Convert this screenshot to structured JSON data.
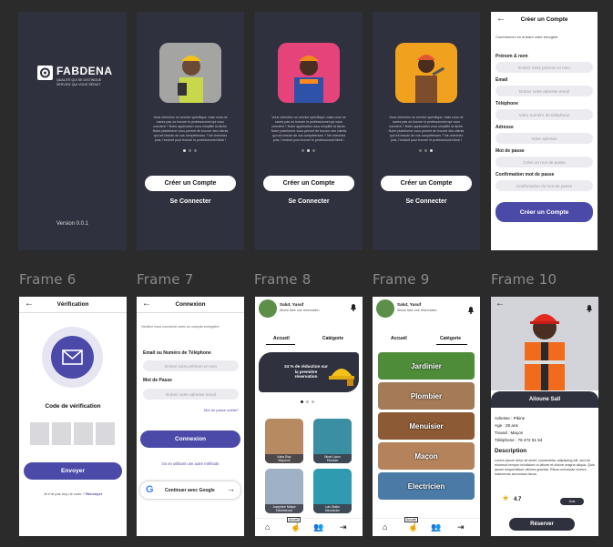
{
  "frame_labels": [
    "Frame 6",
    "Frame 7",
    "Frame 8",
    "Frame 9",
    "Frame 10"
  ],
  "splash": {
    "brand": "FABDENA",
    "brand_tagline_1": "QUALITÉ QUI SE DISTINGUE",
    "brand_tagline_2": "SERVICE QUI VOUS SÉDUIT",
    "version": "Version 0.0.1"
  },
  "onboarding": {
    "paragraph": "Vous cherchez un service spécifique, mais vous ne savez pas où trouver le professionnel qui vous convient ? Notre application vous simplifie la tâche. Notre plateforme vous permet de trouver des clients qui ont besoin de vos compétences ? Ne cherchez plus, l'endroit pour trouver le professionnel idéal !",
    "create_label": "Créer un Compte",
    "login_label": "Se Connecter"
  },
  "signup": {
    "title": "Créer un Compte",
    "intro": "Commencez en entrant votre enregistr",
    "fields": [
      {
        "label": "Prénom & nom",
        "placeholder": "Entrez votre prénom et nom"
      },
      {
        "label": "Email",
        "placeholder": "Entrez votre adresse email"
      },
      {
        "label": "Téléphone",
        "placeholder": "Votre numéro de téléphone"
      },
      {
        "label": "Adresse",
        "placeholder": "Votre adresse"
      },
      {
        "label": "Mot de passe",
        "placeholder": "Créer un mot de passe"
      },
      {
        "label": "Confirmation mot de passe",
        "placeholder": "Confirmation du mot de passe"
      }
    ],
    "submit": "Créer un Compte"
  },
  "verification": {
    "title": "Vérification",
    "code_label": "Code de vérification",
    "send": "Envoyer",
    "resend_prompt": "Je n'ai pas reçu le code ?",
    "resend_link": "Renvoyer"
  },
  "login": {
    "title": "Connexion",
    "intro": "Veuillez vous connecter avec un compte enregistré",
    "email_label": "Email ou Numéro de Téléphone",
    "email_placeholder": "Entrez votre prénom et nom",
    "password_label": "Mot de Passe",
    "password_placeholder": "Entrez votre adresse email",
    "forgot": "Mot de passe oublié?",
    "submit": "Connexion",
    "alt": "Ou en utilisant une autre méthode",
    "google": "Continuer avec Google"
  },
  "home": {
    "greeting": "Salut, Yusuf",
    "subtitle": "Allons faire une réservation",
    "tab_home": "Accueil",
    "tab_category": "Catégorie",
    "promo": "24 % de réduction sur la première réservation",
    "workers": [
      {
        "name": "Kaba Diop",
        "job": "Maçonne"
      },
      {
        "name": "Nkosi Lulum",
        "job": "Plombier"
      },
      {
        "name": "Josephine Ndiaye",
        "job": "Electricienne"
      },
      {
        "name": "Luis Okafor",
        "job": "Mécanicien"
      }
    ],
    "nav_active": "Accueil"
  },
  "categories": {
    "items": [
      "Jardinier",
      "Plombier",
      "Menuisier",
      "Maçon",
      "Electricien"
    ]
  },
  "profile": {
    "name": "Alioune Sall",
    "address": "Adresse : Pikine",
    "age": "Age : 29 ans",
    "job": "Travail : Maçon",
    "phone": "Téléphone : 76 472 51 54",
    "desc_title": "Description",
    "desc": "Lorem ipsum dolor sit amet, consectetur adipiscing elit, sed do eiusmod tempor incididunt ut labore et dolore magna aliqua. Quis ipsum suspendisse ultrices gravida. Risus commodo viverra maecenas accumsan lacus.",
    "rating": "4.7",
    "review_btn": "Avis",
    "book": "Réserver"
  },
  "colors": {
    "dark": "#2f313e",
    "primary": "#4c4aa8",
    "canvas": "#2b2b2b"
  }
}
